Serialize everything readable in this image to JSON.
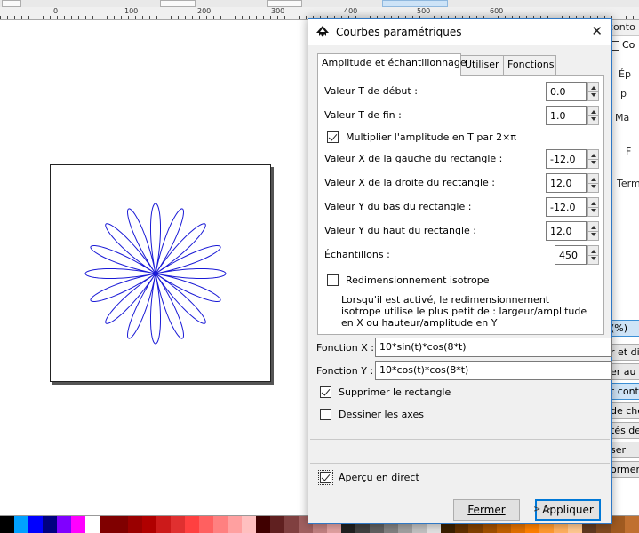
{
  "ruler": {
    "labels": [
      "0",
      "100",
      "200",
      "300",
      "400",
      "500",
      "600"
    ]
  },
  "dock": {
    "top_label": "conto",
    "check_label": "Co",
    "texts": [
      "Ép",
      "p",
      "Ma",
      "F",
      "Term"
    ],
    "percent_label": "(%)",
    "buttons": [
      "r et di",
      "er au f",
      "t cont",
      "de che",
      "tés de",
      "ser",
      "ormer"
    ],
    "scroll_label": "> ⊳"
  },
  "dialog": {
    "title": "Courbes paramétriques",
    "close_glyph": "✕",
    "tabs": [
      "Amplitude et échantillonnage",
      "Utiliser",
      "Fonctions"
    ],
    "fields": {
      "t_start": {
        "label": "Valeur T de début :",
        "value": "0.0"
      },
      "t_end": {
        "label": "Valeur T de fin :",
        "value": "1.0"
      },
      "multiply": {
        "label": "Multiplier l'amplitude en T par 2×π",
        "checked": true
      },
      "x_left": {
        "label": "Valeur X de la gauche du rectangle :",
        "value": "-12.0"
      },
      "x_right": {
        "label": "Valeur X de la droite du rectangle :",
        "value": "12.0"
      },
      "y_bottom": {
        "label": "Valeur Y du bas du rectangle :",
        "value": "-12.0"
      },
      "y_top": {
        "label": "Valeur Y du haut du rectangle :",
        "value": "12.0"
      },
      "samples": {
        "label": "Échantillons :",
        "value": "450"
      },
      "isotropic": {
        "label": "Redimensionnement isotrope",
        "checked": false
      },
      "isotropic_desc": "Lorsqu'il est activé, le redimensionnement isotrope utilise le plus petit de : largeur/amplitude en X ou hauteur/amplitude en Y"
    },
    "fx": {
      "label": "Fonction X :",
      "value": "10*sin(t)*cos(8*t)"
    },
    "fy": {
      "label": "Fonction Y :",
      "value": "10*cos(t)*cos(8*t)"
    },
    "remove_rect": {
      "label": "Supprimer le rectangle",
      "checked": true
    },
    "draw_axes": {
      "label": "Dessiner les axes",
      "checked": false
    },
    "live_preview": {
      "label": "Aperçu en direct",
      "checked": true
    },
    "close_button": "Fermer",
    "apply_button": "Appliquer"
  },
  "curve": {
    "color": "#1a1ad6",
    "petals": 16
  },
  "palette": [
    "#000000",
    "#00a0ff",
    "#0000ff",
    "#000080",
    "#8000ff",
    "#ff00ff",
    "#ffffff",
    "#800000",
    "#800000",
    "#9a0000",
    "#b00000",
    "#cc1a1a",
    "#e03030",
    "#ff4040",
    "#ff6060",
    "#ff8080",
    "#ffa0a0",
    "#ffc0c0",
    "#400000",
    "#602020",
    "#804040",
    "#a06060",
    "#c08080",
    "#e0a0a0",
    "#202020",
    "#404040",
    "#606060",
    "#808080",
    "#a0a0a0",
    "#c0c0c0",
    "#e0e0e0",
    "#3a2000",
    "#603000",
    "#804000",
    "#a05000",
    "#c06000",
    "#e07000",
    "#ff8000",
    "#ff9a30",
    "#ffb060",
    "#ffc890",
    "#603a20",
    "#804a20",
    "#a05a20",
    "#c07030"
  ]
}
